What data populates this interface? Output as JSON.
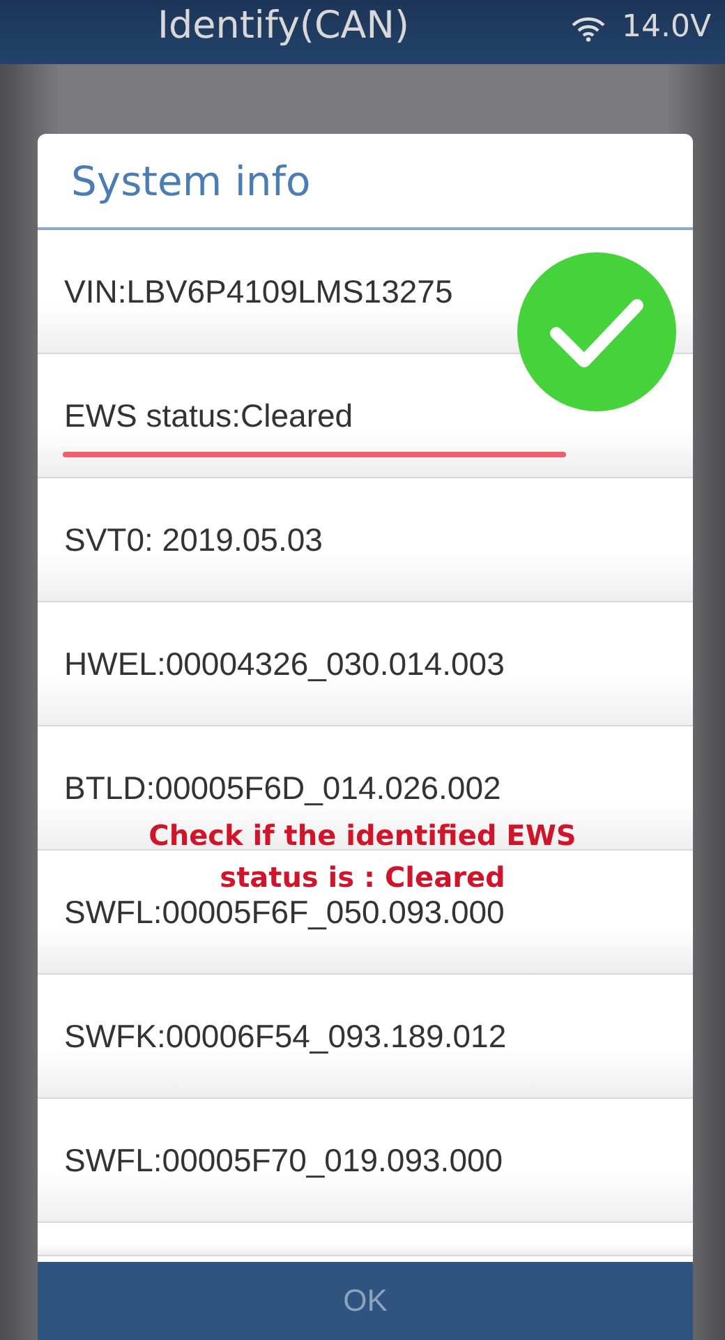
{
  "header": {
    "title": "Identify(CAN)",
    "voltage": "14.0V"
  },
  "dialog": {
    "title": "System info",
    "rows": [
      {
        "text": "VIN:LBV6P4109LMS13275",
        "underlined": false
      },
      {
        "text": "EWS status:Cleared",
        "underlined": true
      },
      {
        "text": "SVT0: 2019.05.03",
        "underlined": false
      },
      {
        "text": "HWEL:00004326_030.014.003",
        "underlined": false
      },
      {
        "text": "BTLD:00005F6D_014.026.002",
        "underlined": false
      },
      {
        "text": "SWFL:00005F6F_050.093.000",
        "underlined": false
      },
      {
        "text": "SWFK:00006F54_093.189.012",
        "underlined": false
      },
      {
        "text": "SWFL:00005F70_019.093.000",
        "underlined": false
      }
    ],
    "button": "OK"
  },
  "annotation": {
    "check_mark": true,
    "lines": [
      "Check if the identified EWS",
      "status is : Cleared"
    ]
  }
}
